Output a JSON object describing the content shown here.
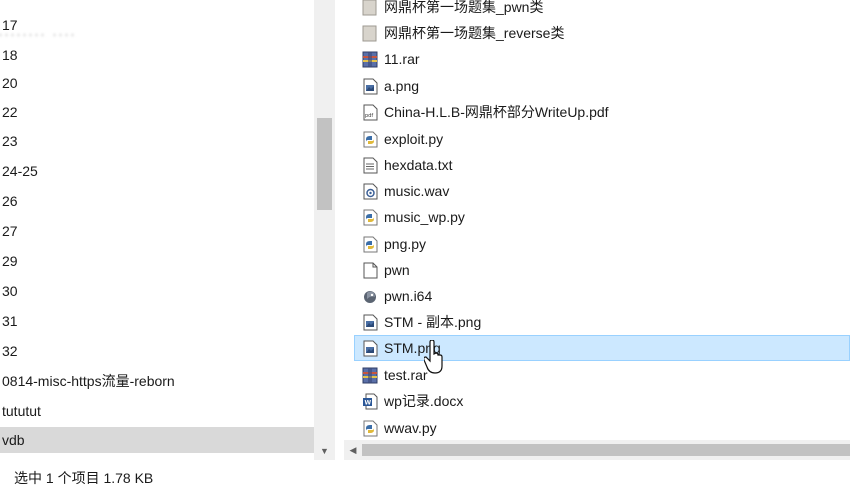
{
  "nav": {
    "items": [
      {
        "label": "17"
      },
      {
        "label": "18"
      },
      {
        "label": "20"
      },
      {
        "label": "22"
      },
      {
        "label": "23"
      },
      {
        "label": "24-25"
      },
      {
        "label": "26"
      },
      {
        "label": "27"
      },
      {
        "label": "29"
      },
      {
        "label": "30"
      },
      {
        "label": "31"
      },
      {
        "label": "32"
      },
      {
        "label": "0814-misc-https流量-reborn"
      },
      {
        "label": "tututut"
      },
      {
        "label": "vdb",
        "selected": true
      }
    ]
  },
  "files": [
    {
      "name": "网鼎杯第一场题集_pwn类",
      "icon": "folder-icon"
    },
    {
      "name": "网鼎杯第一场题集_reverse类",
      "icon": "folder-icon"
    },
    {
      "name": "11.rar",
      "icon": "rar-archive-icon"
    },
    {
      "name": "a.png",
      "icon": "image-file-icon"
    },
    {
      "name": "China-H.L.B-网鼎杯部分WriteUp.pdf",
      "icon": "pdf-file-icon"
    },
    {
      "name": "exploit.py",
      "icon": "python-file-icon"
    },
    {
      "name": "hexdata.txt",
      "icon": "text-file-icon"
    },
    {
      "name": "music.wav",
      "icon": "audio-file-icon"
    },
    {
      "name": "music_wp.py",
      "icon": "python-file-icon"
    },
    {
      "name": "png.py",
      "icon": "python-file-icon"
    },
    {
      "name": "pwn",
      "icon": "blank-file-icon"
    },
    {
      "name": "pwn.i64",
      "icon": "ida-database-icon"
    },
    {
      "name": "STM - 副本.png",
      "icon": "image-file-icon"
    },
    {
      "name": "STM.png",
      "icon": "image-file-icon",
      "selected": true
    },
    {
      "name": "test.rar",
      "icon": "rar-archive-icon"
    },
    {
      "name": "wp记录.docx",
      "icon": "word-document-icon"
    },
    {
      "name": "wwav.py",
      "icon": "python-file-icon"
    }
  ],
  "status": {
    "text": "选中 1 个项目  1.78 KB"
  },
  "colors": {
    "selection_fill": "#cce8ff",
    "selection_border": "#99d1ff",
    "nav_selected": "#d9d9d9",
    "scrollbar_track": "#f0f0f0",
    "scrollbar_thumb": "#c2c2c2"
  }
}
